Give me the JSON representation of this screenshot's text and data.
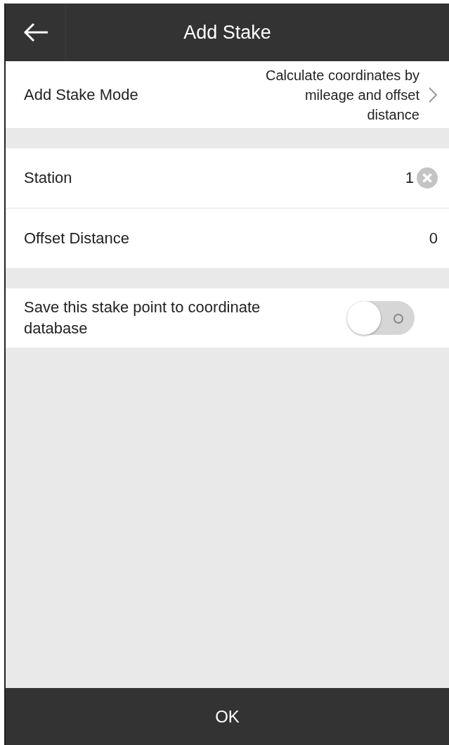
{
  "header": {
    "title": "Add Stake"
  },
  "mode_row": {
    "label": "Add Stake Mode",
    "value": "Calculate coordinates by mileage and offset distance"
  },
  "fields": [
    {
      "label": "Station",
      "value": "1",
      "clearable": true
    },
    {
      "label": "Offset Distance",
      "value": "0",
      "clearable": false
    }
  ],
  "save_option": {
    "label": "Save this stake point to coordinate database",
    "on": false
  },
  "ok_button": "OK"
}
